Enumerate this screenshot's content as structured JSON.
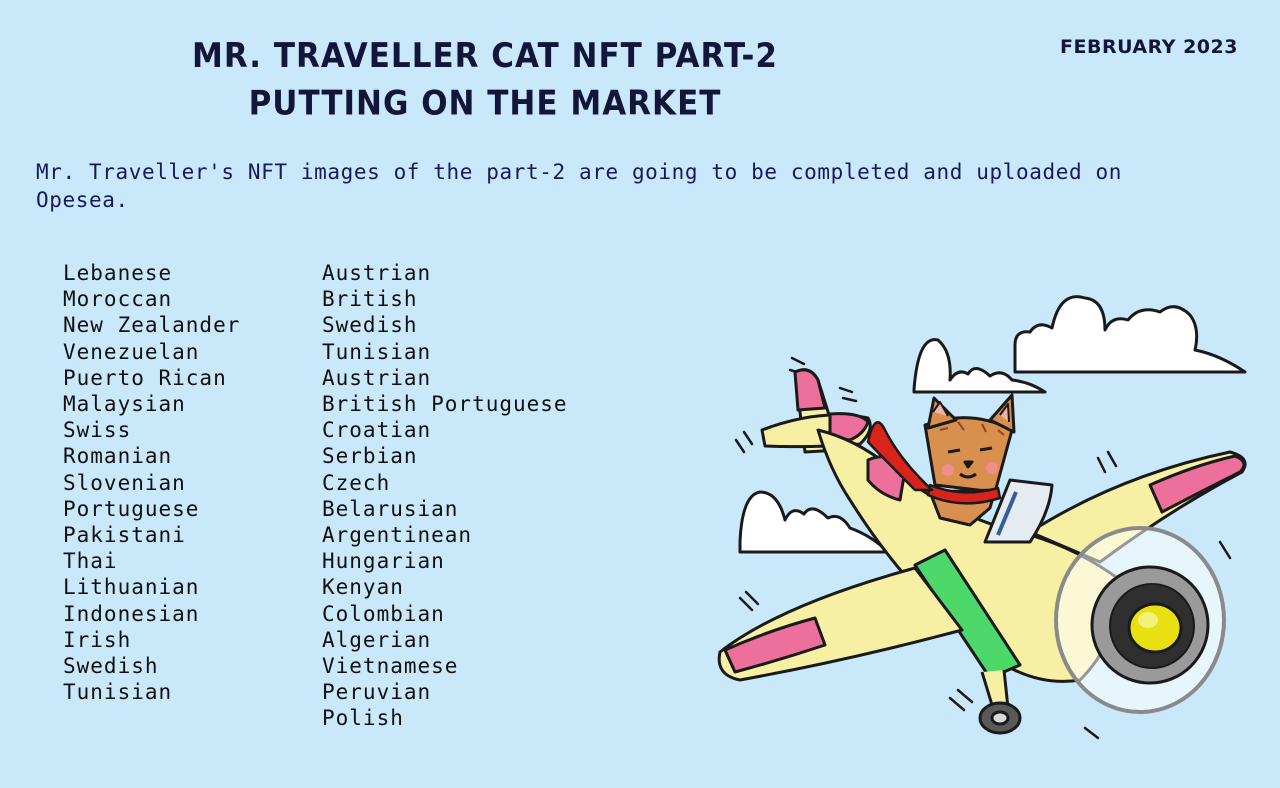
{
  "header": {
    "title_line1": "MR. TRAVELLER CAT NFT PART-2",
    "title_line2": "PUTTING ON THE MARKET",
    "date": "FEBRUARY 2023"
  },
  "intro": "Mr. Traveller's NFT images of the part-2 are going to be completed and uploaded on Opesea.",
  "lists": {
    "column1": [
      "Lebanese",
      "Moroccan",
      "New Zealander",
      "Venezuelan",
      "Puerto Rican",
      "Malaysian",
      "Swiss",
      "Romanian",
      "Slovenian",
      "Portuguese",
      "Pakistani",
      "Thai",
      "Lithuanian",
      "Indonesian",
      "Irish",
      "Swedish",
      "Tunisian"
    ],
    "column2": [
      "Austrian",
      "British",
      "Swedish",
      "Tunisian",
      "Austrian",
      "British Portuguese",
      "Croatian",
      "Serbian",
      "Czech",
      "Belarusian",
      "Argentinean",
      "Hungarian",
      "Kenyan",
      "Colombian",
      "Algerian",
      "Vietnamese",
      "Peruvian",
      "Polish"
    ]
  },
  "illustration": {
    "subject": "cat-pilot-airplane-illustration",
    "colors": {
      "background": "#c9e8f9",
      "plane": "#f7f0a4",
      "accent": "#ec6f9c",
      "stripe": "#4cd96a",
      "cat": "#d9904f",
      "scarf": "#d9241c"
    }
  }
}
